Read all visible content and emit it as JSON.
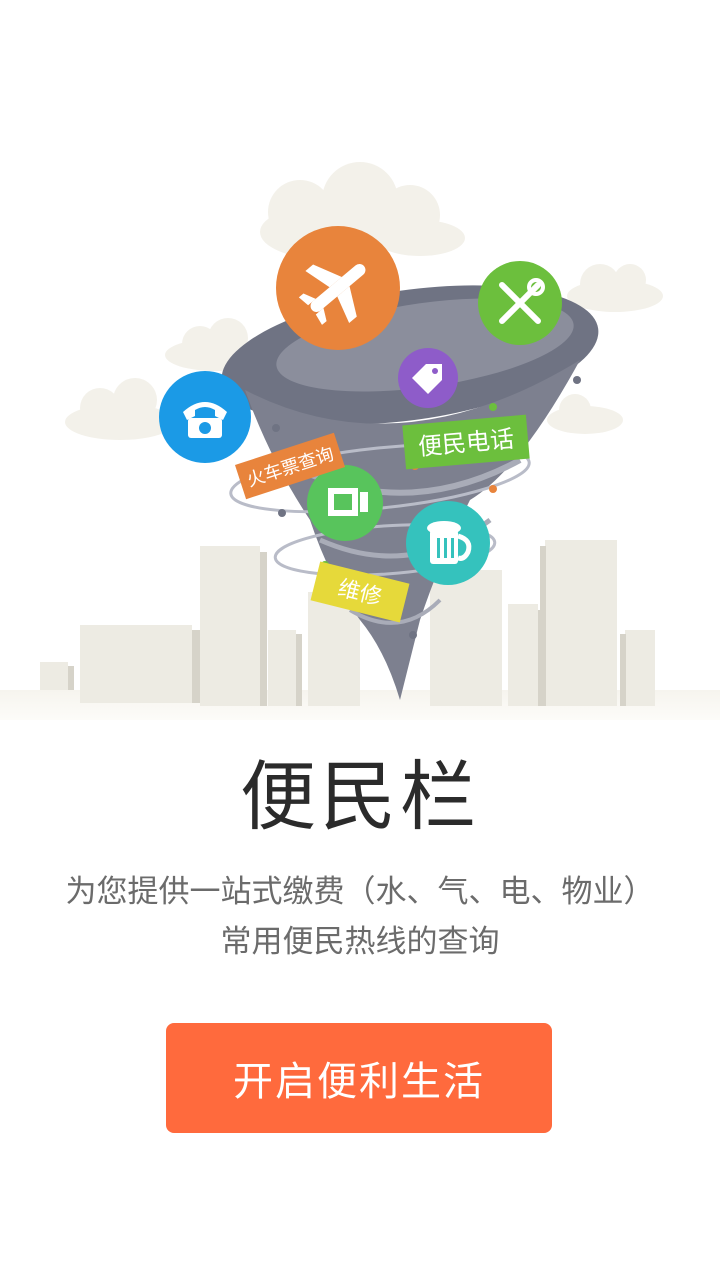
{
  "illustration": {
    "tags": {
      "train_ticket": "火车票查询",
      "hotline": "便民电话",
      "repair": "维修"
    },
    "icons": [
      "airplane-icon",
      "wrench-screwdriver-icon",
      "tag-icon",
      "telephone-icon",
      "film-icon",
      "beer-mug-icon"
    ],
    "colors": {
      "airplane": "#e8843c",
      "tools": "#6cbf3d",
      "tag": "#8e5cc9",
      "phone": "#1b9ae6",
      "film": "#58c45c",
      "beer": "#35c2bd",
      "tornado": "#7d808f",
      "buildings": "#edebe3"
    }
  },
  "title": "便民栏",
  "description": {
    "line1": "为您提供一站式缴费（水、气、电、物业）",
    "line2": "常用便民热线的查询"
  },
  "cta": {
    "label": "开启便利生活",
    "color": "#ff6a3d"
  }
}
